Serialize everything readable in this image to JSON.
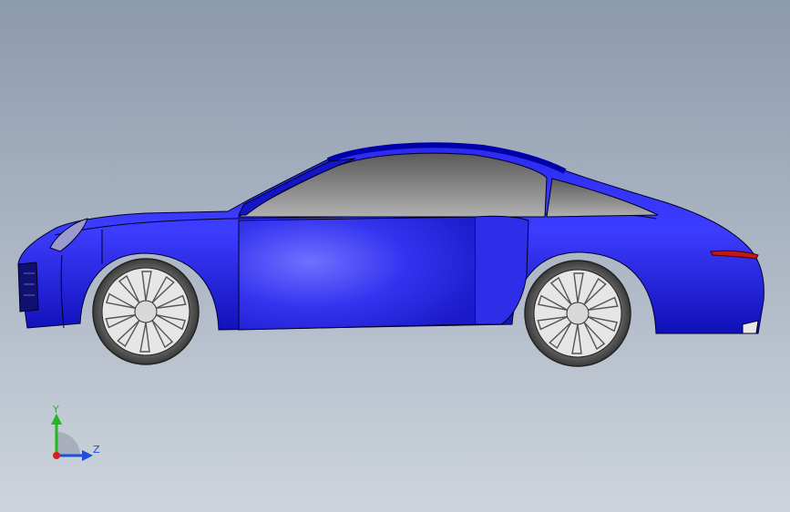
{
  "viewport": {
    "background_top": "#8c9aad",
    "background_bottom": "#cdd4dc"
  },
  "model": {
    "body_color": "#1a1ad6",
    "glass_color": "#8a8a8a",
    "tire_color": "#4a4a4a",
    "rim_color": "#d0d0d0",
    "taillight_color": "#c01818"
  },
  "triad": {
    "y_label": "Y",
    "z_label": "Z",
    "y_color": "#1fb81f",
    "z_color": "#1f4fd8",
    "x_color": "#d81f1f"
  }
}
